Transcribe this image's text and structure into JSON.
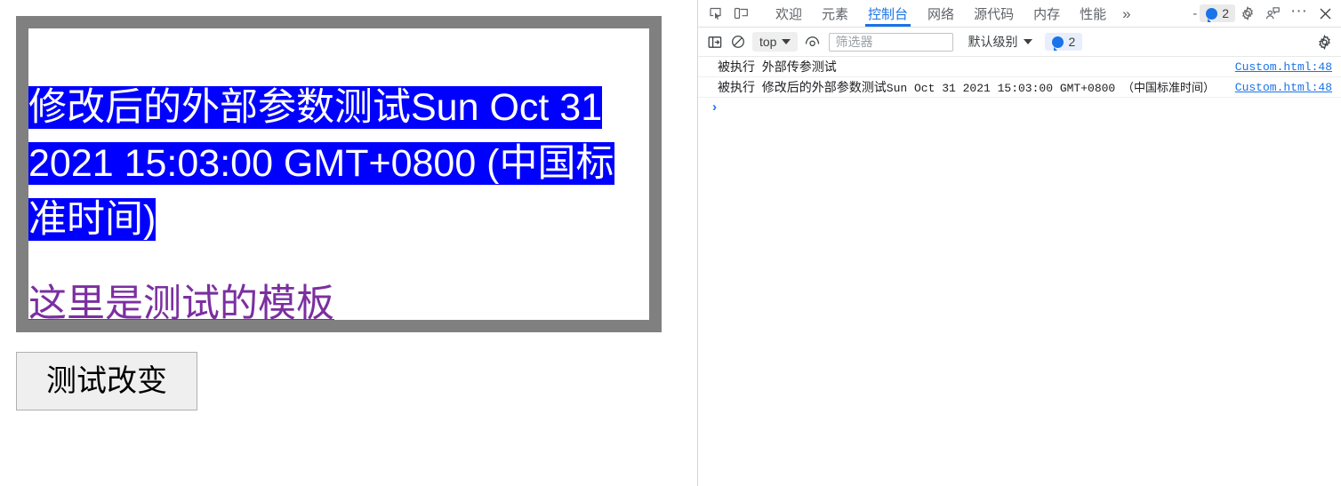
{
  "page": {
    "paragraph_text": "修改后的外部参数测试Sun Oct 31 2021 15:03:00 GMT+0800 (中国标准时间)",
    "link_text": "这里是测试的模板",
    "button_label": "测试改变",
    "selection_color": "#0000ff",
    "link_color": "#7b2fa0",
    "frame_border_color": "#808080"
  },
  "devtools": {
    "tabs": [
      {
        "label": "欢迎",
        "active": false
      },
      {
        "label": "元素",
        "active": false
      },
      {
        "label": "控制台",
        "active": true
      },
      {
        "label": "网络",
        "active": false
      },
      {
        "label": "源代码",
        "active": false
      },
      {
        "label": "内存",
        "active": false
      },
      {
        "label": "性能",
        "active": false
      }
    ],
    "tab_overflow": "»",
    "tab_minus": "-",
    "tab_message_count": "2",
    "accent_color": "#1a73e8",
    "console_toolbar": {
      "context_label": "top",
      "filter_placeholder": "筛选器",
      "filter_value": "",
      "level_label": "默认级别",
      "issue_count": "2"
    },
    "console_rows": [
      {
        "prefix": "被执行",
        "message": "外部传参测试",
        "mono_suffix": "",
        "source": "Custom.html:48"
      },
      {
        "prefix": "被执行",
        "message": "修改后的外部参数测试",
        "mono_suffix": "Sun Oct 31 2021 15:03:00 GMT+0800 （中国标准时间）",
        "source": "Custom.html:48"
      }
    ],
    "prompt_caret": "›",
    "prompt_value": ""
  }
}
